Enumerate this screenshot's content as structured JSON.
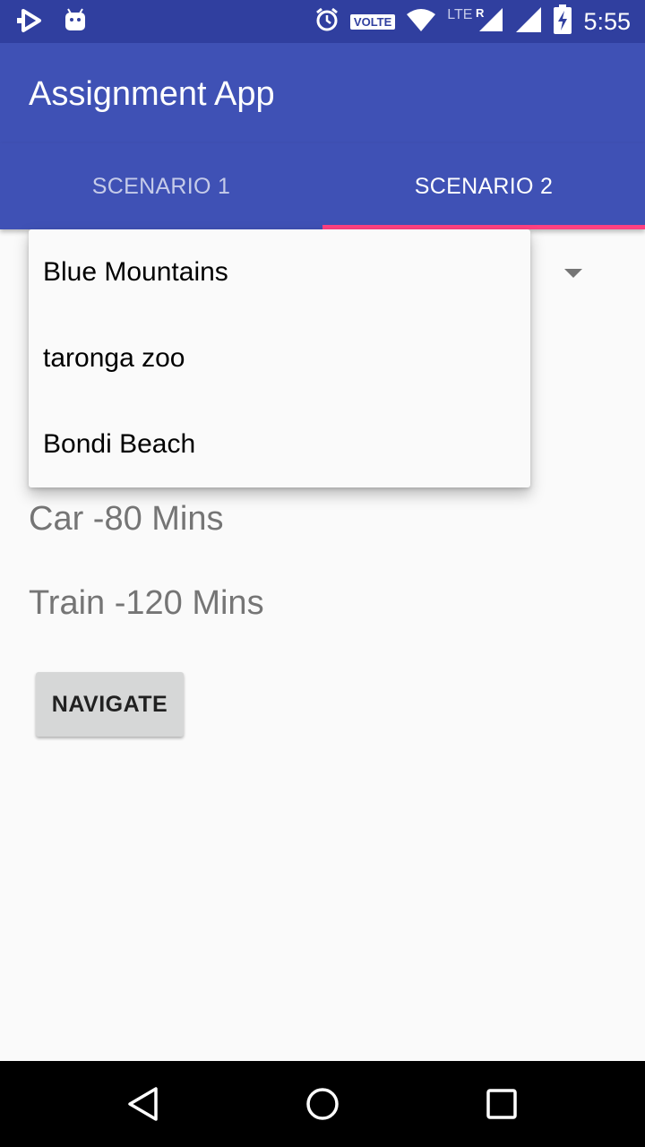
{
  "status_bar": {
    "time": "5:55",
    "volte": "VOLTE",
    "lte": "LTE",
    "icons": [
      "play-store-icon",
      "android-icon",
      "alarm-icon",
      "wifi-icon",
      "signal-icon",
      "battery-icon"
    ]
  },
  "app": {
    "title": "Assignment App"
  },
  "tabs": [
    {
      "label": "SCENARIO 1",
      "selected": false
    },
    {
      "label": "SCENARIO 2",
      "selected": true
    }
  ],
  "dropdown": {
    "options": [
      "Blue Mountains",
      "taronga zoo",
      "Bondi Beach"
    ]
  },
  "content": {
    "car": "Car -80 Mins",
    "train": "Train -120 Mins",
    "navigate_label": "NAVIGATE"
  },
  "colors": {
    "primary": "#3F51B5",
    "primary_dark": "#303F9F",
    "accent": "#FF4081"
  }
}
